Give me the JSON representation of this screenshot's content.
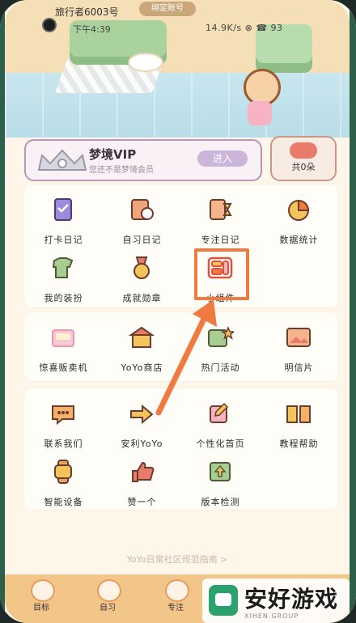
{
  "status_bar": {
    "title": "旅行者6003号",
    "badge": "绑定账号",
    "time": "下午4:39",
    "right_status": "14.9K/s ⊗ ☎ 93"
  },
  "vip": {
    "title": "梦境VIP",
    "subtitle": "您还不是梦境会员",
    "button": "进入"
  },
  "flowers": {
    "label": "共0朵"
  },
  "grid1": [
    {
      "label": "打卡日记",
      "icon": "checklist-icon"
    },
    {
      "label": "自习日记",
      "icon": "book-clock-icon"
    },
    {
      "label": "专注日记",
      "icon": "hourglass-book-icon"
    },
    {
      "label": "数据统计",
      "icon": "pie-chart-icon"
    },
    {
      "label": "我的装扮",
      "icon": "shirt-icon"
    },
    {
      "label": "成就勋章",
      "icon": "medal-icon"
    },
    {
      "label": "小组件",
      "icon": "widget-icon"
    }
  ],
  "grid2": [
    {
      "label": "惊喜贩卖机",
      "icon": "vending-machine-icon"
    },
    {
      "label": "YoYo商店",
      "icon": "shop-icon"
    },
    {
      "label": "热门活动",
      "icon": "calendar-star-icon"
    },
    {
      "label": "明信片",
      "icon": "postcard-icon"
    }
  ],
  "grid3": [
    {
      "label": "联系我们",
      "icon": "chat-icon"
    },
    {
      "label": "安利YoYo",
      "icon": "share-icon"
    },
    {
      "label": "个性化首页",
      "icon": "customize-icon"
    },
    {
      "label": "教程帮助",
      "icon": "open-book-icon"
    },
    {
      "label": "智能设备",
      "icon": "watch-icon"
    },
    {
      "label": "赞一个",
      "icon": "thumbs-up-icon"
    },
    {
      "label": "版本检测",
      "icon": "update-icon"
    }
  ],
  "footer_link": "YoYo日常社区规范指南 >",
  "tabs": [
    {
      "label": "目标"
    },
    {
      "label": "自习"
    },
    {
      "label": "专注"
    }
  ],
  "watermark": {
    "text": "安好游戏",
    "small": "XIHEN.GROUP"
  },
  "colors": {
    "accent_orange": "#f07a3f",
    "tabbar": "#f2c589",
    "background": "#fff6ea"
  }
}
